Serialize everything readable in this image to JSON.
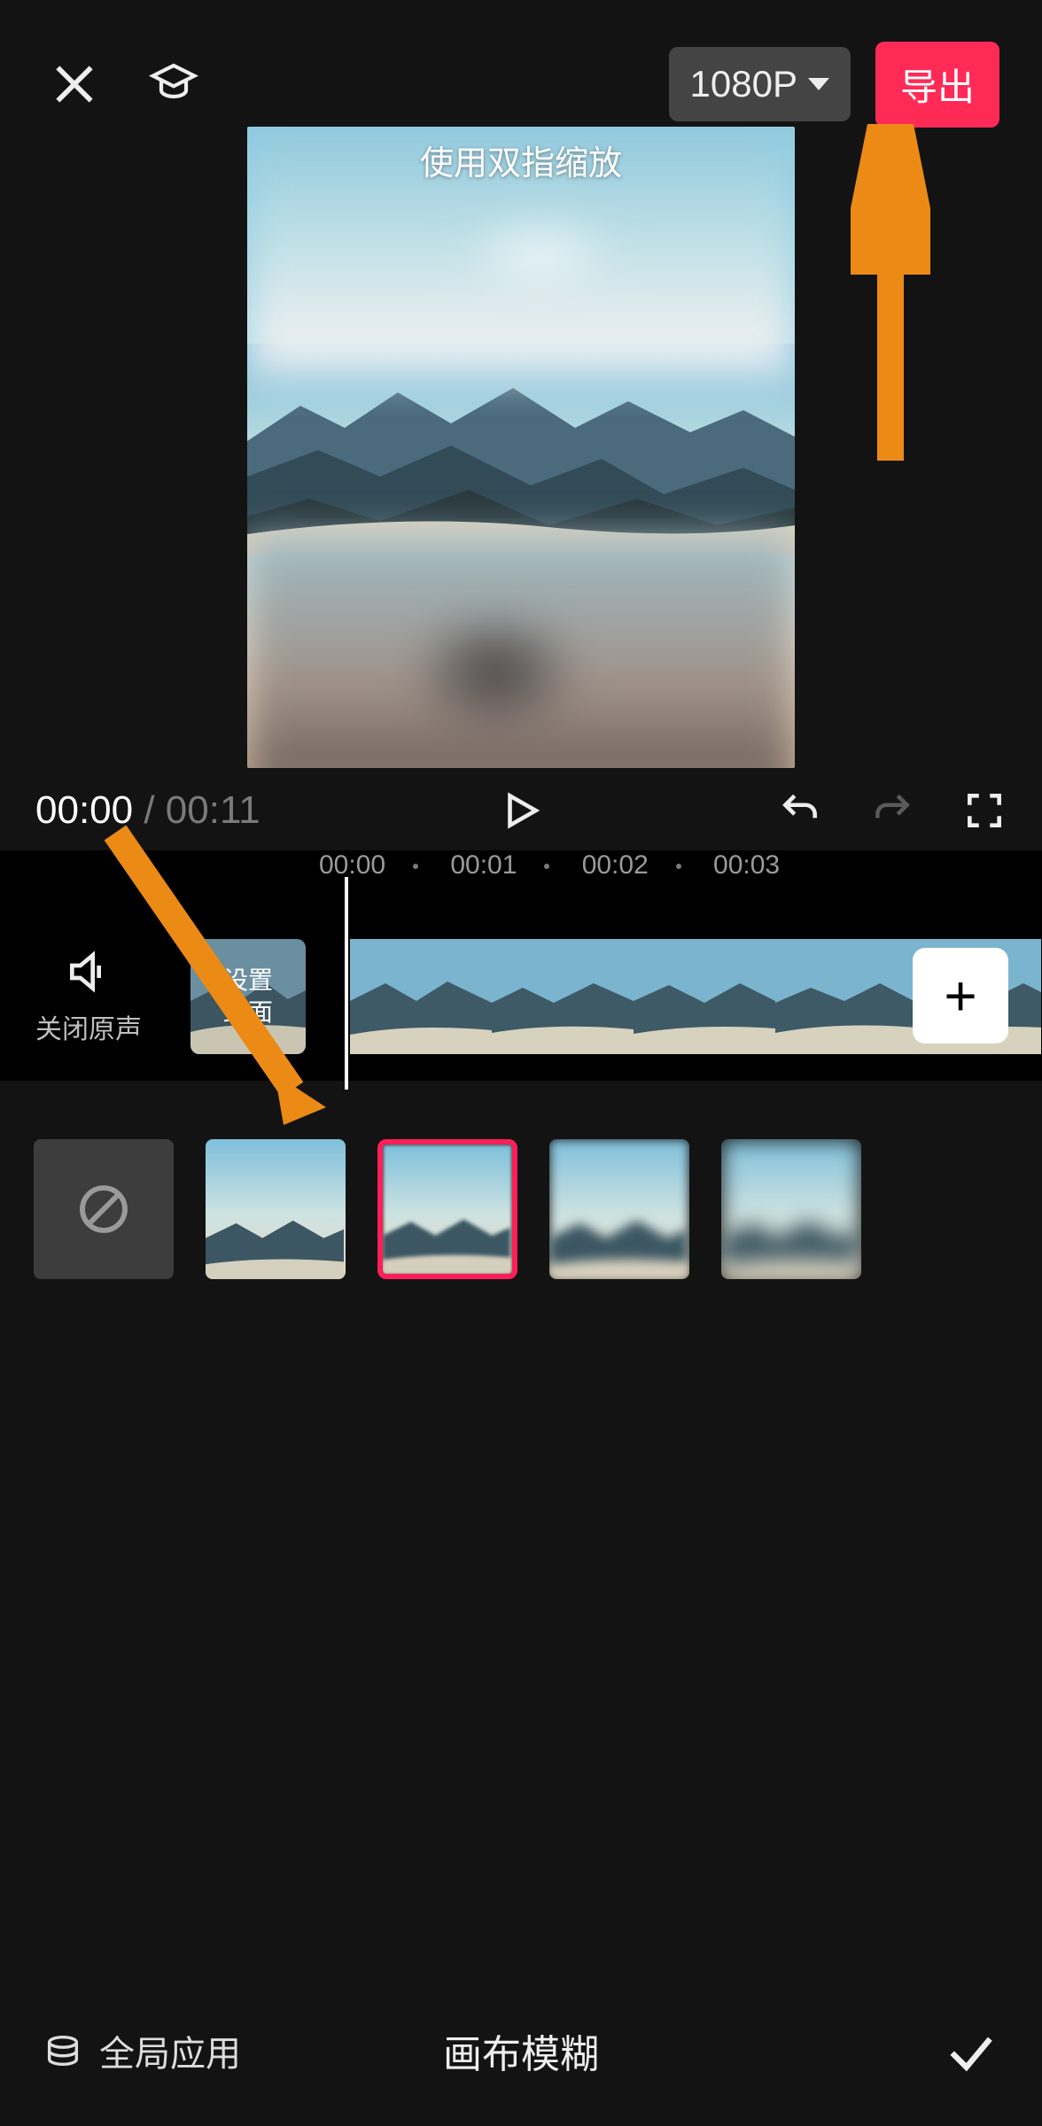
{
  "header": {
    "resolution_label": "1080P",
    "export_label": "导出"
  },
  "preview": {
    "pinch_hint": "使用双指缩放"
  },
  "playback": {
    "current_time": "00:00",
    "separator": " / ",
    "total_time": "00:11"
  },
  "timeline": {
    "ticks": [
      "00:00",
      "00:01",
      "00:02",
      "00:03"
    ],
    "mute_label": "关闭原声",
    "cover_label": "设置\n封面"
  },
  "blur_options": {
    "selected_index": 2
  },
  "bottom": {
    "global_apply": "全局应用",
    "panel_title": "画布模糊"
  }
}
